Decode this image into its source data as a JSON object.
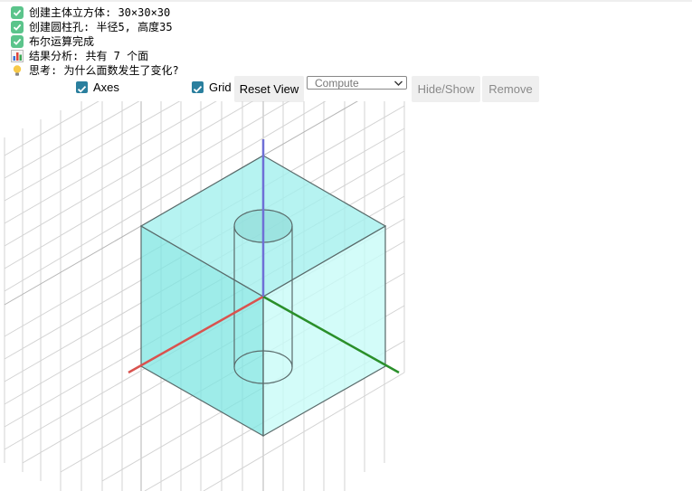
{
  "log": [
    {
      "icon": "check-icon",
      "text": "创建主体立方体: 30×30×30"
    },
    {
      "icon": "check-icon",
      "text": "创建圆柱孔: 半径5, 高度35"
    },
    {
      "icon": "check-icon",
      "text": "布尔运算完成"
    },
    {
      "icon": "bar-chart-icon",
      "text": "结果分析: 共有 7 个面"
    },
    {
      "icon": "lightbulb-icon",
      "text": "思考: 为什么面数发生了变化?"
    }
  ],
  "controls": {
    "axes_label": "Axes",
    "axes_checked": true,
    "grid_label": "Grid",
    "grid_checked": true,
    "reset_view_label": "Reset View",
    "select_value": "Compute",
    "hide_show_label": "Hide/Show",
    "remove_label": "Remove"
  },
  "colors": {
    "cube_face_left": "#7ee6e2",
    "cube_face_top": "#a4f0ed",
    "cube_face_right": "#c8fbf8",
    "edge": "#5a6b6b",
    "axis_x": "#d9534f",
    "axis_y": "#2a8f2a",
    "axis_z": "#6f6fd6",
    "grid": "#d0d0d0",
    "checkbox": "#2a7f9e"
  }
}
